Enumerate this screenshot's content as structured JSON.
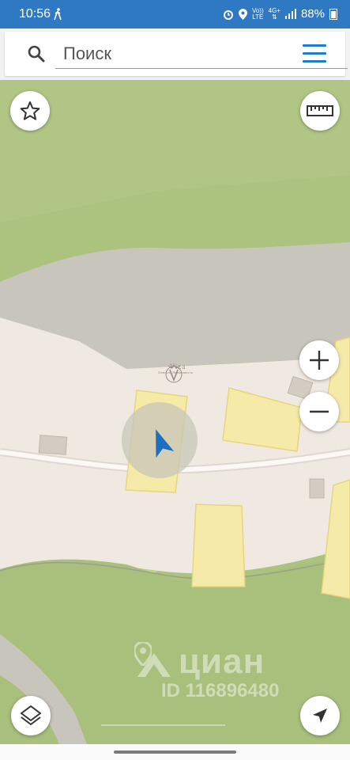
{
  "status_bar": {
    "time": "10:56",
    "network_top": "Vo))",
    "network_bottom": "LTE",
    "net_type": "4G+",
    "battery": "88%"
  },
  "search": {
    "placeholder": "Поиск"
  },
  "watermark": {
    "agency_name": "Viza",
    "agency_sub": "Агентство Недвижимости",
    "cian_logo": "циан",
    "cian_id": "ID 116896480"
  },
  "colors": {
    "status_bar": "#2f78c2",
    "menu_accent": "#1d80c3",
    "map_green": "#acc27f",
    "map_pale": "#f1e9e0",
    "parcel_yellow": "#f6eaa8"
  },
  "controls": {
    "favorite": "star-icon",
    "ruler": "ruler-icon",
    "zoom_in": "plus-icon",
    "zoom_out": "minus-icon",
    "layers": "layers-icon",
    "locate": "navigation-arrow-icon"
  }
}
